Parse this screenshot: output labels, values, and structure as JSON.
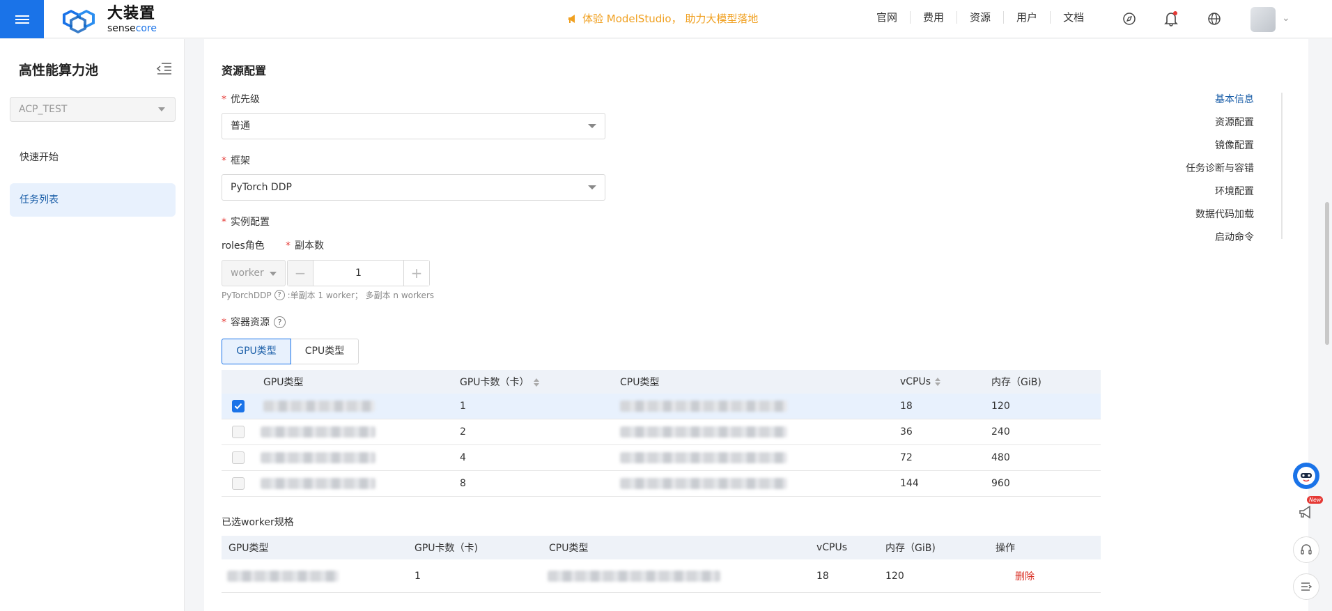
{
  "header": {
    "logo_cn": "大装置",
    "logo_en_1": "sense",
    "logo_en_2": "core",
    "promo_text": "体验 ModelStudio， 助力大模型落地",
    "nav": [
      "官网",
      "费用",
      "资源",
      "用户",
      "文档"
    ]
  },
  "sidebar": {
    "title": "高性能算力池",
    "pool_select": "ACP_TEST",
    "items": [
      {
        "label": "快速开始"
      },
      {
        "label": "任务列表"
      }
    ]
  },
  "form": {
    "section_title": "资源配置",
    "priority": {
      "label": "优先级",
      "value": "普通"
    },
    "framework": {
      "label": "框架",
      "value": "PyTorch DDP"
    },
    "instance": {
      "label": "实例配置",
      "roles_label": "roles角色",
      "replicas_label": "副本数",
      "role_value": "worker",
      "replicas_value": "1",
      "hint_prefix": "PyTorchDDP",
      "hint_text": ":单副本 1 worker； 多副本 n workers"
    },
    "container": {
      "label": "容器资源",
      "tabs": [
        "GPU类型",
        "CPU类型"
      ]
    }
  },
  "gpu_table": {
    "headers": [
      "GPU类型",
      "GPU卡数（卡）",
      "CPU类型",
      "vCPUs",
      "内存（GiB)"
    ],
    "rows": [
      {
        "gpus": "1",
        "vcpus": "18",
        "mem": "120",
        "checked": true
      },
      {
        "gpus": "2",
        "vcpus": "36",
        "mem": "240",
        "checked": false
      },
      {
        "gpus": "4",
        "vcpus": "72",
        "mem": "480",
        "checked": false
      },
      {
        "gpus": "8",
        "vcpus": "144",
        "mem": "960",
        "checked": false
      }
    ]
  },
  "selected": {
    "title": "已选worker规格",
    "headers": [
      "GPU类型",
      "GPU卡数（卡)",
      "CPU类型",
      "vCPUs",
      "内存（GiB)",
      "操作"
    ],
    "row": {
      "gpus": "1",
      "vcpus": "18",
      "mem": "120",
      "action": "删除"
    }
  },
  "anchors": [
    "基本信息",
    "资源配置",
    "镜像配置",
    "任务诊断与容错",
    "环境配置",
    "数据代码加载",
    "启动命令"
  ],
  "floats": {
    "new_badge": "New"
  },
  "colors": {
    "accent": "#1a73e8",
    "promo": "#f0a020",
    "danger": "#d93025"
  }
}
